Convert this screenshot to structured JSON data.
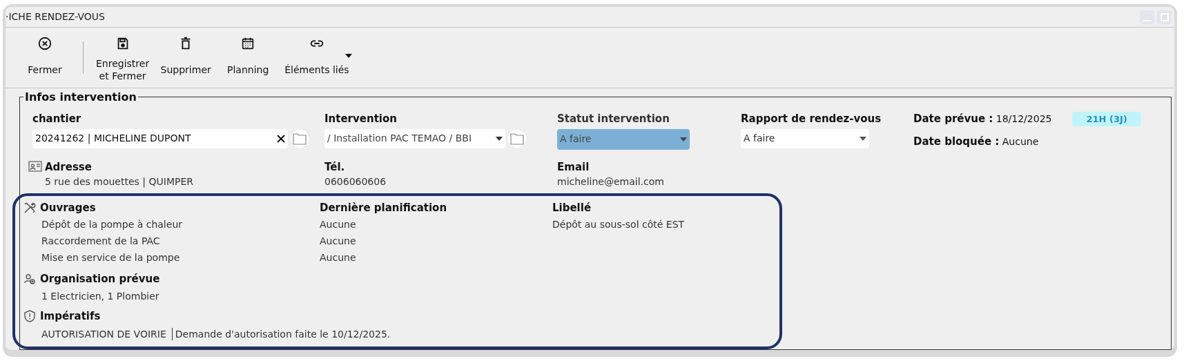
{
  "window": {
    "title": "·ICHE RENDEZ-VOUS"
  },
  "toolbar": [
    {
      "label": "Fermer",
      "has_menu": false
    },
    {
      "label": "Enregistrer\net Fermer",
      "has_menu": false
    },
    {
      "label": "Supprimer",
      "has_menu": false
    },
    {
      "label": "Planning",
      "has_menu": false
    },
    {
      "label": "Éléments liés",
      "has_menu": true
    }
  ],
  "section": {
    "legend": "Infos intervention"
  },
  "fields": [
    {
      "kind": "text",
      "label": "chantier",
      "value": "20241262 | MICHELINE DUPONT"
    },
    {
      "kind": "select",
      "label": "Intervention",
      "value": "/ Installation PAC TEMAO / BBI"
    },
    {
      "kind": "status",
      "label": "Statut intervention",
      "value": "A faire"
    },
    {
      "kind": "plain",
      "label": "Rapport de rendez-vous",
      "value": "A faire"
    }
  ],
  "dates": {
    "planned_label": "Date prévue :",
    "planned_value": "18/12/2025",
    "badge": "21H (3J)",
    "blocked_label": "Date bloquée :",
    "blocked_value": "Aucune"
  },
  "contact": [
    {
      "label": "Adresse",
      "value": "5 rue des mouettes | QUIMPER"
    },
    {
      "label": "Tél.",
      "value": "0606060606"
    },
    {
      "label": "Email",
      "value": "micheline@email.com"
    }
  ],
  "works": {
    "columns": [
      "Ouvrages",
      "Dernière planification",
      "Libellé"
    ],
    "rows": [
      [
        "Dépôt de la pompe à chaleur",
        "Aucune",
        "Dépôt au sous-sol côté EST"
      ],
      [
        "Raccordement de la PAC",
        "Aucune",
        ""
      ],
      [
        "Mise en service de la pompe",
        "Aucune",
        ""
      ]
    ]
  },
  "organisation": {
    "label": "Organisation prévue",
    "value": "1 Electricien, 1 Plombier"
  },
  "imperatifs": {
    "label": "Impératifs",
    "code": "AUTORISATION DE VOIRIE",
    "note": "Demande d'autorisation faite le 10/12/2025."
  }
}
